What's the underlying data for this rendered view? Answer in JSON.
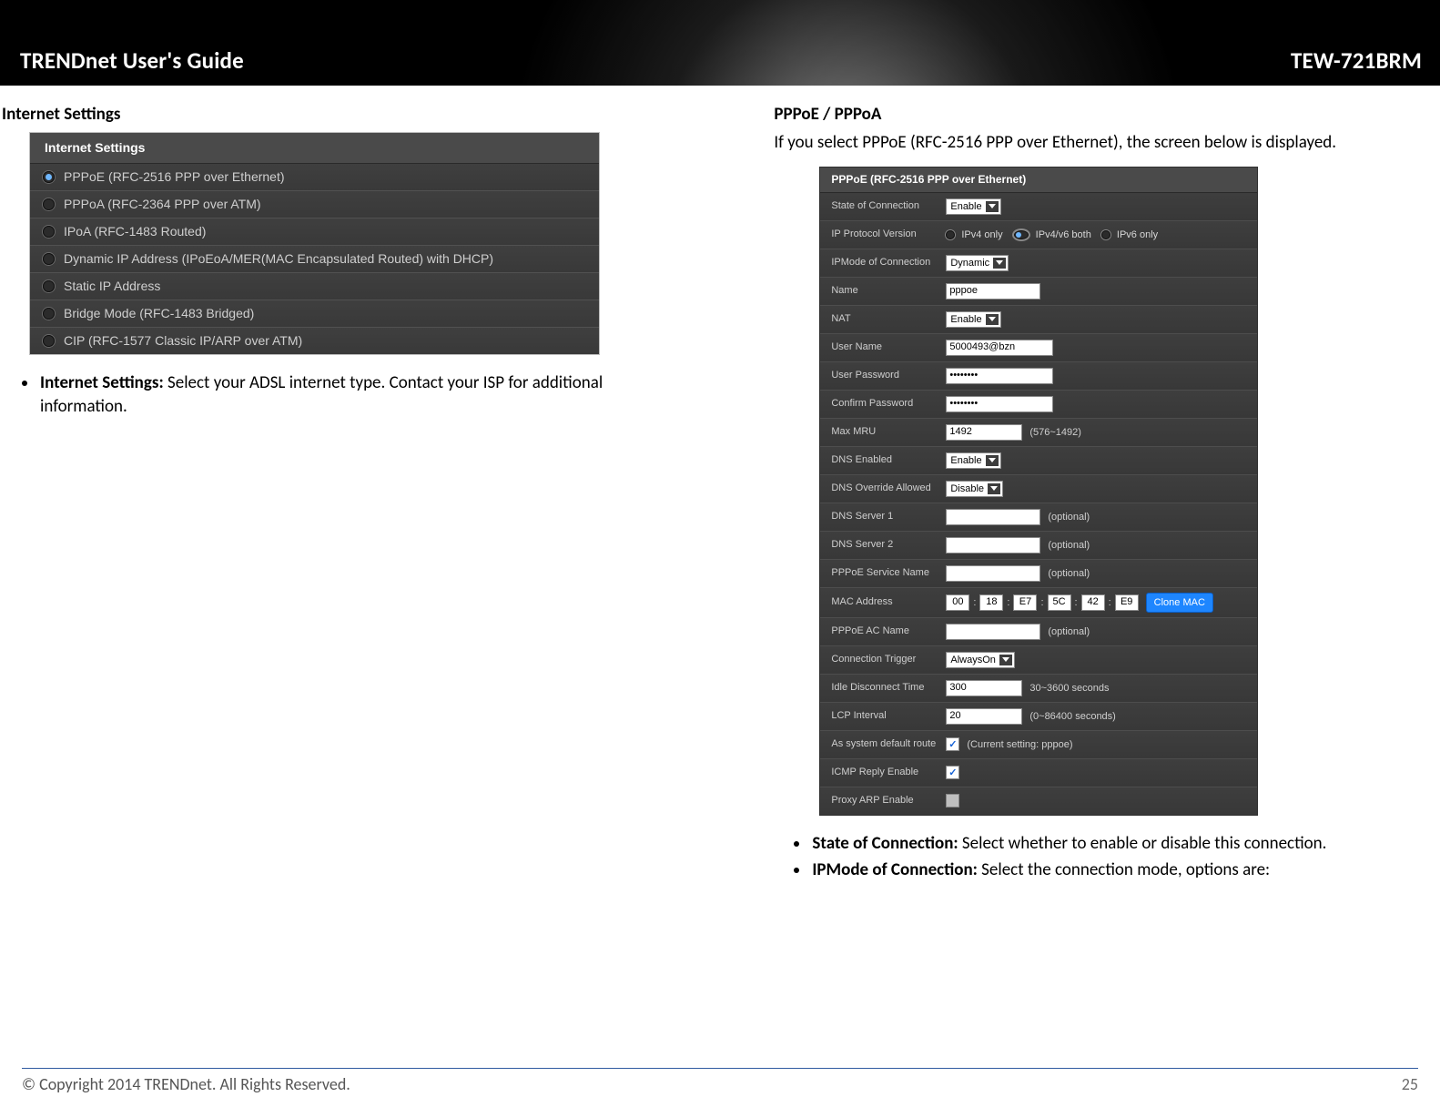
{
  "banner": {
    "left_title": "TRENDnet User's Guide",
    "right_title": "TEW-721BRM"
  },
  "left_col": {
    "heading": "Internet Settings",
    "radio_panel_title": "Internet Settings",
    "radio_options": [
      {
        "label": "PPPoE (RFC-2516 PPP over Ethernet)",
        "selected": true
      },
      {
        "label": "PPPoA (RFC-2364 PPP over ATM)",
        "selected": false
      },
      {
        "label": "IPoA (RFC-1483 Routed)",
        "selected": false
      },
      {
        "label": "Dynamic IP Address (IPoEoA/MER(MAC Encapsulated Routed) with DHCP)",
        "selected": false
      },
      {
        "label": "Static IP Address",
        "selected": false
      },
      {
        "label": "Bridge Mode (RFC-1483 Bridged)",
        "selected": false
      },
      {
        "label": "CIP (RFC-1577 Classic IP/ARP over ATM)",
        "selected": false
      }
    ],
    "bullet": {
      "label": "Internet Settings:",
      "text": " Select your ADSL internet type. Contact your ISP for additional information."
    }
  },
  "right_col": {
    "heading": "PPPoE / PPPoA",
    "intro": "If you select PPPoE (RFC-2516 PPP over Ethernet), the screen below is displayed.",
    "form_title": "PPPoE (RFC-2516 PPP over Ethernet)",
    "rows": {
      "state_of_connection": {
        "label": "State of Connection",
        "value": "Enable"
      },
      "ip_protocol_version": {
        "label": "IP Protocol Version",
        "opts": [
          "IPv4 only",
          "IPv4/v6 both",
          "IPv6 only"
        ],
        "selected": "IPv4/v6 both"
      },
      "ipmode": {
        "label": "IPMode of Connection",
        "value": "Dynamic"
      },
      "name": {
        "label": "Name",
        "value": "pppoe"
      },
      "nat": {
        "label": "NAT",
        "value": "Enable"
      },
      "user_name": {
        "label": "User Name",
        "value": "5000493@bzn"
      },
      "user_password": {
        "label": "User Password",
        "value": "••••••••"
      },
      "confirm_password": {
        "label": "Confirm Password",
        "value": "••••••••"
      },
      "max_mru": {
        "label": "Max MRU",
        "value": "1492",
        "hint": "(576~1492)"
      },
      "dns_enabled": {
        "label": "DNS Enabled",
        "value": "Enable"
      },
      "dns_override": {
        "label": "DNS Override Allowed",
        "value": "Disable"
      },
      "dns1": {
        "label": "DNS Server 1",
        "value": "",
        "hint": "(optional)"
      },
      "dns2": {
        "label": "DNS Server 2",
        "value": "",
        "hint": "(optional)"
      },
      "svc_name": {
        "label": "PPPoE Service Name",
        "value": "",
        "hint": "(optional)"
      },
      "mac": {
        "label": "MAC Address",
        "oct": [
          "00",
          "18",
          "E7",
          "5C",
          "42",
          "E9"
        ],
        "btn": "Clone MAC"
      },
      "ac_name": {
        "label": "PPPoE AC Name",
        "value": "",
        "hint": "(optional)"
      },
      "conn_trigger": {
        "label": "Connection Trigger",
        "value": "AlwaysOn"
      },
      "idle": {
        "label": "Idle Disconnect Time",
        "value": "300",
        "hint": "30~3600 seconds"
      },
      "lcp": {
        "label": "LCP Interval",
        "value": "20",
        "hint": "(0~86400 seconds)"
      },
      "def_route": {
        "label": "As system default route",
        "checked": true,
        "hint": "(Current setting: pppoe)"
      },
      "icmp": {
        "label": "ICMP Reply Enable",
        "checked": true
      },
      "proxy_arp": {
        "label": "Proxy ARP Enable",
        "checked": false
      }
    },
    "bullets": [
      {
        "label": "State of Connection:",
        "text": " Select whether to enable or disable this connection."
      },
      {
        "label": "IPMode of Connection:",
        "text": " Select the connection mode, options are:"
      }
    ]
  },
  "footer": {
    "copyright": "© Copyright 2014 TRENDnet. All Rights Reserved.",
    "page_number": "25"
  }
}
